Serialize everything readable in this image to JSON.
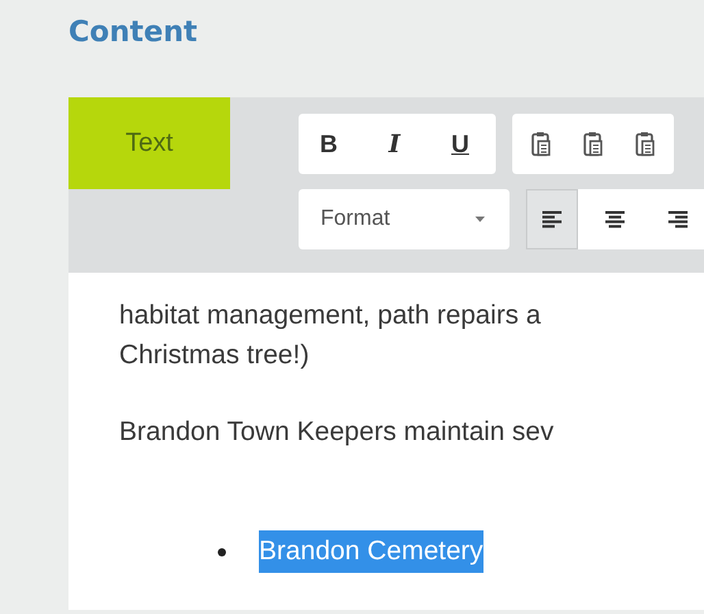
{
  "heading": "Content",
  "mode_tab": {
    "label": "Text",
    "selected": true
  },
  "format_buttons": [
    {
      "label": "B",
      "kind": "bold"
    },
    {
      "label": "I",
      "kind": "italic"
    },
    {
      "label": "U",
      "kind": "underline"
    }
  ],
  "format_dropdown": {
    "label": "Format"
  },
  "align_buttons": [
    {
      "kind": "left",
      "selected": true
    },
    {
      "kind": "center",
      "selected": false
    },
    {
      "kind": "right",
      "selected": false
    }
  ],
  "paragraphs": [
    {
      "lines": [
        "habitat  management, path repairs a",
        "Christmas tree!)"
      ]
    },
    {
      "lines": [
        "Brandon Town Keepers maintain sev"
      ]
    }
  ],
  "list": [
    {
      "text": "Brandon Cemetery",
      "selected": true
    }
  ]
}
